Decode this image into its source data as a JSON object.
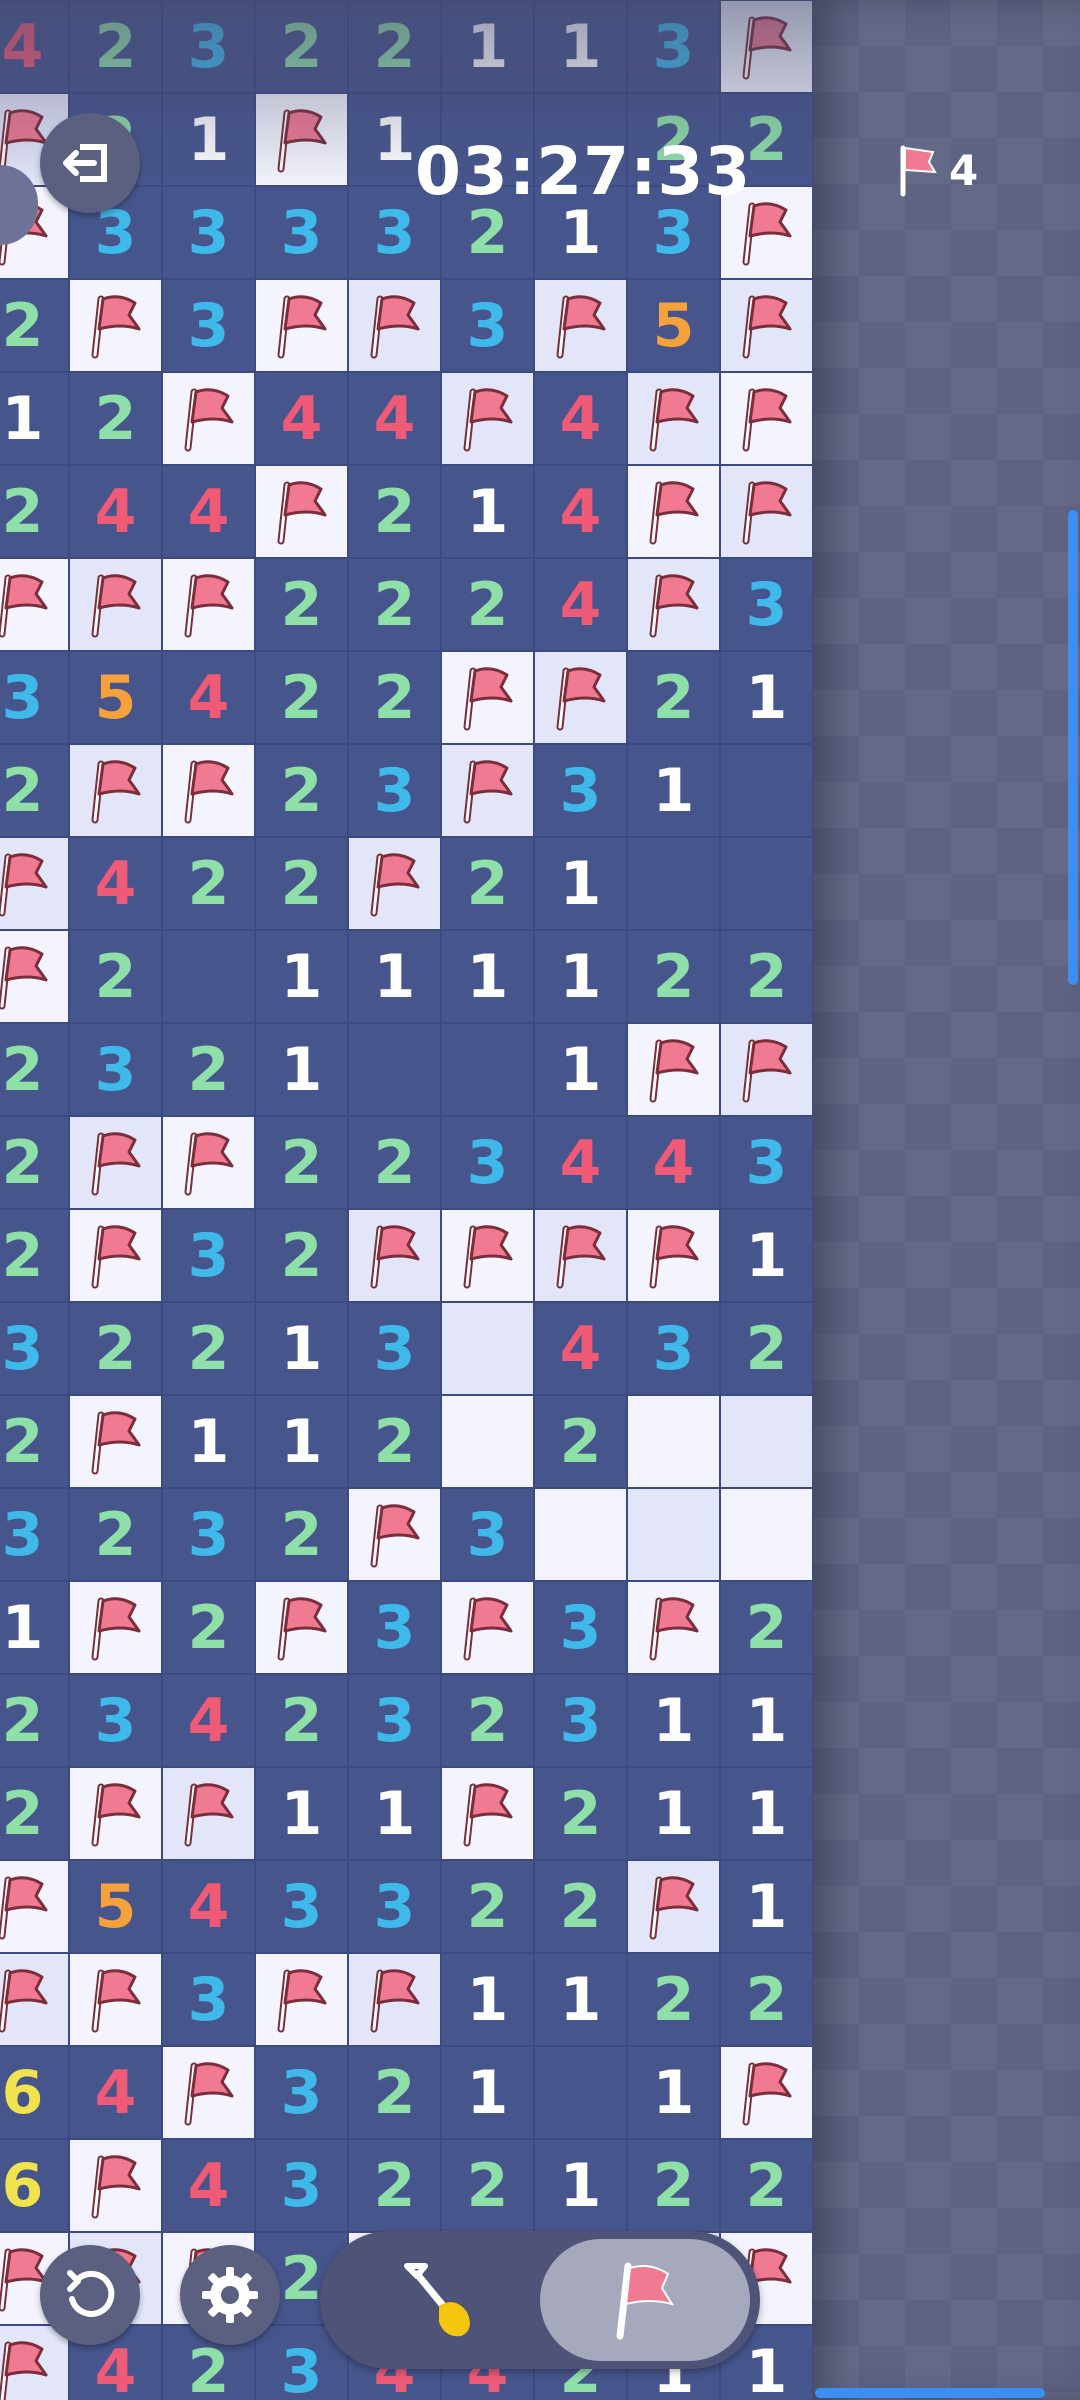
{
  "game": {
    "name": "minesweeper",
    "timer": "03:27:33",
    "flags_remaining": "4",
    "mode": "flag",
    "colors": {
      "n1": "#ffffff",
      "n2": "#8fe0a8",
      "n3": "#3fb8ea",
      "n4": "#ef5a77",
      "n5": "#f6a23c",
      "n6": "#f1e34e",
      "flag": "#f07a92"
    }
  },
  "controls": {
    "exit_icon": "exit-icon",
    "undo_icon": "undo-icon",
    "settings_icon": "gear-icon",
    "dig_icon": "shovel-icon",
    "flag_icon": "flag-icon"
  },
  "board": {
    "rows": [
      [
        "4",
        "2",
        "3",
        "2",
        "2",
        "1",
        "1",
        "3",
        "F"
      ],
      [
        "F",
        "2",
        "1",
        "F",
        "1",
        "",
        "",
        "2",
        "2"
      ],
      [
        "F",
        "3",
        "3",
        "3",
        "3",
        "2",
        "1",
        "3",
        "F"
      ],
      [
        "2",
        "F",
        "3",
        "F",
        "F",
        "3",
        "F",
        "5",
        "F"
      ],
      [
        "1",
        "2",
        "F",
        "4",
        "4",
        "F",
        "4",
        "F",
        "F"
      ],
      [
        "2",
        "4",
        "4",
        "F",
        "2",
        "1",
        "4",
        "F",
        "F"
      ],
      [
        "F",
        "F",
        "F",
        "2",
        "2",
        "2",
        "4",
        "F",
        "3"
      ],
      [
        "3",
        "5",
        "4",
        "2",
        "2",
        "F",
        "F",
        "2",
        "1"
      ],
      [
        "2",
        "F",
        "F",
        "2",
        "3",
        "F",
        "3",
        "1",
        "."
      ],
      [
        "F",
        "4",
        "2",
        "2",
        "F",
        "2",
        "1",
        ".",
        "."
      ],
      [
        "F",
        "2",
        ".",
        "1",
        "1",
        "1",
        "1",
        "2",
        "2"
      ],
      [
        "2",
        "3",
        "2",
        "1",
        ".",
        ".",
        "1",
        "F",
        "F"
      ],
      [
        "2",
        "F",
        "F",
        "2",
        "2",
        "3",
        "4",
        "4",
        "3"
      ],
      [
        "2",
        "F",
        "3",
        "2",
        "F",
        "F",
        "F",
        "F",
        "1"
      ],
      [
        "3",
        "2",
        "2",
        "1",
        "3",
        "#",
        "4",
        "3",
        "2"
      ],
      [
        "2",
        "F",
        "1",
        "1",
        "2",
        "#",
        "2",
        "#",
        "#"
      ],
      [
        "3",
        "2",
        "3",
        "2",
        "F",
        "3",
        "#",
        "#",
        "#"
      ],
      [
        "1",
        "F",
        "2",
        "F",
        "3",
        "F",
        "3",
        "F",
        "2"
      ],
      [
        "2",
        "3",
        "4",
        "2",
        "3",
        "2",
        "3",
        "1",
        "1"
      ],
      [
        "2",
        "F",
        "F",
        "1",
        "1",
        "F",
        "2",
        "1",
        "1"
      ],
      [
        "F",
        "5",
        "4",
        "3",
        "3",
        "2",
        "2",
        "F",
        "1"
      ],
      [
        "F",
        "F",
        "3",
        "F",
        "F",
        "1",
        "1",
        "2",
        "2"
      ],
      [
        "6",
        "4",
        "F",
        "3",
        "2",
        "1",
        ".",
        "1",
        "F"
      ],
      [
        "6",
        "F",
        "4",
        "3",
        "2",
        "2",
        "1",
        "2",
        "2"
      ],
      [
        "F",
        "F",
        "F",
        "2",
        "F",
        "F",
        "F",
        "F",
        "F"
      ],
      [
        "F",
        "4",
        "2",
        "3",
        "4",
        "4",
        "2",
        "1",
        "1"
      ]
    ]
  }
}
